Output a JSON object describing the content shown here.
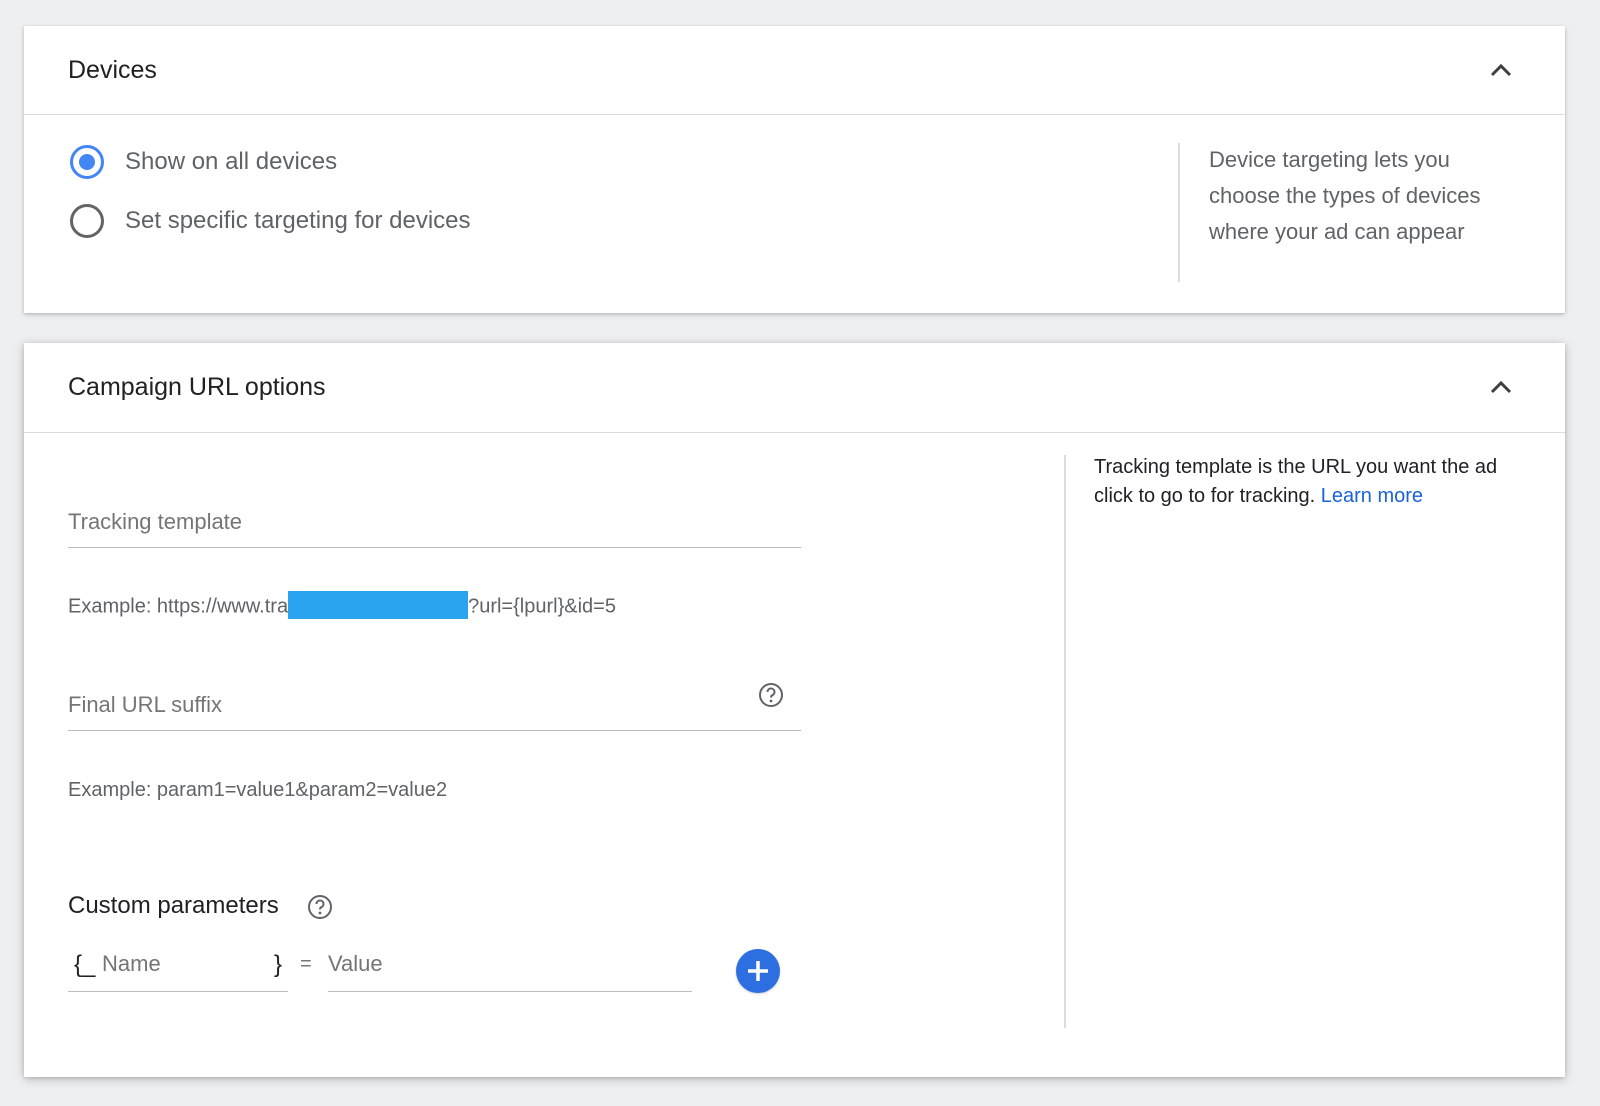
{
  "devices": {
    "title": "Devices",
    "options": [
      {
        "label": "Show on all devices",
        "selected": true
      },
      {
        "label": "Set specific targeting for devices",
        "selected": false
      }
    ],
    "help_lines": [
      "Device targeting lets you",
      "choose the types of devices",
      "where your ad can appear"
    ]
  },
  "campaign_url": {
    "title": "Campaign URL options",
    "tracking_template": {
      "placeholder": "Tracking template",
      "value": "",
      "example_prefix": "Example: https://www.tra",
      "example_suffix": "?url={lpurl}&id=5"
    },
    "final_url_suffix": {
      "placeholder": "Final URL suffix",
      "value": "",
      "example": "Example: param1=value1&param2=value2"
    },
    "custom_parameters": {
      "label": "Custom parameters",
      "open_brace": "{_",
      "close_brace": "}",
      "name_placeholder": "Name",
      "equals": "=",
      "value_placeholder": "Value"
    },
    "help": {
      "text": "Tracking template is the URL you want the ad click to go to for tracking.",
      "link": "Learn more"
    }
  },
  "colors": {
    "accent": "#4285f4",
    "add_button": "#2d6fe0",
    "link": "#1a62d6",
    "redaction": "#2aa4ee"
  },
  "icons": {
    "collapse": "chevron-up-icon",
    "help": "help-circle-icon",
    "add": "plus-icon"
  }
}
